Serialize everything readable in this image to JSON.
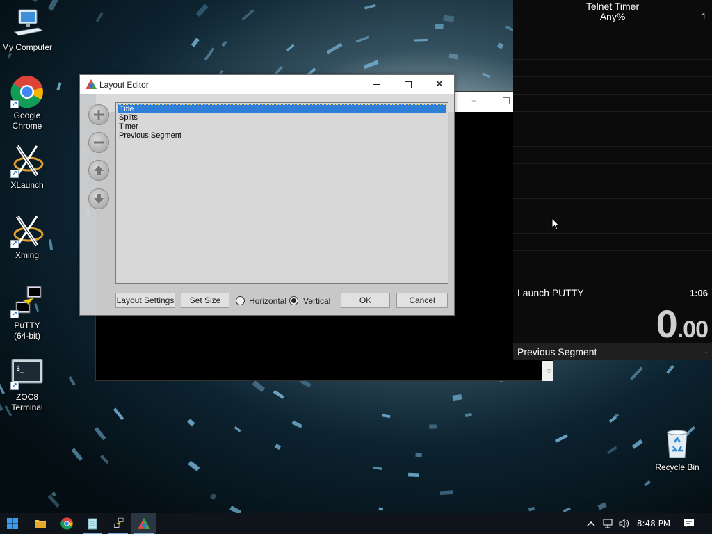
{
  "desktop": {
    "icons": [
      {
        "name": "my-computer",
        "label": "My Computer"
      },
      {
        "name": "google-chrome",
        "label": "Google\nChrome"
      },
      {
        "name": "xlaunch",
        "label": "XLaunch"
      },
      {
        "name": "xming",
        "label": "Xming"
      },
      {
        "name": "putty",
        "label": "PuTTY\n(64-bit)"
      },
      {
        "name": "zoc8-terminal",
        "label": "ZOC8\nTerminal"
      },
      {
        "name": "recycle-bin",
        "label": "Recycle Bin"
      }
    ]
  },
  "timer": {
    "title": "Telnet Timer",
    "category": "Any%",
    "attempts": "1",
    "current_split_name": "Launch PUTTY",
    "current_split_time": "1:06",
    "main_time_whole": "0",
    "main_time_fraction": ".00",
    "previous_segment_label": "Previous Segment",
    "previous_segment_value": "-"
  },
  "layout_editor": {
    "title": "Layout Editor",
    "components": [
      "Title",
      "Splits",
      "Timer",
      "Previous Segment"
    ],
    "selected_index": 0,
    "buttons": {
      "layout_settings": "Layout Settings",
      "set_size": "Set Size",
      "ok": "OK",
      "cancel": "Cancel"
    },
    "orientation": {
      "horizontal_label": "Horizontal",
      "vertical_label": "Vertical",
      "selected": "Vertical"
    },
    "side_buttons": [
      "add-icon",
      "remove-icon",
      "move-up-icon",
      "move-down-icon"
    ]
  },
  "taskbar": {
    "apps": [
      "start-icon",
      "file-explorer-icon",
      "chrome-icon",
      "notepad-icon",
      "putty-icon",
      "livesplit-icon"
    ],
    "clock": "8:48 PM",
    "tray_icons": [
      "chevron-up-icon",
      "network-icon",
      "volume-icon"
    ],
    "action_center": "action-center-icon"
  },
  "colors": {
    "selection": "#2f7fd6",
    "timer_bg": "#0b0b0b",
    "taskbar_bg": "#0e141a",
    "wallpaper_accent": "#7fc2e8"
  }
}
